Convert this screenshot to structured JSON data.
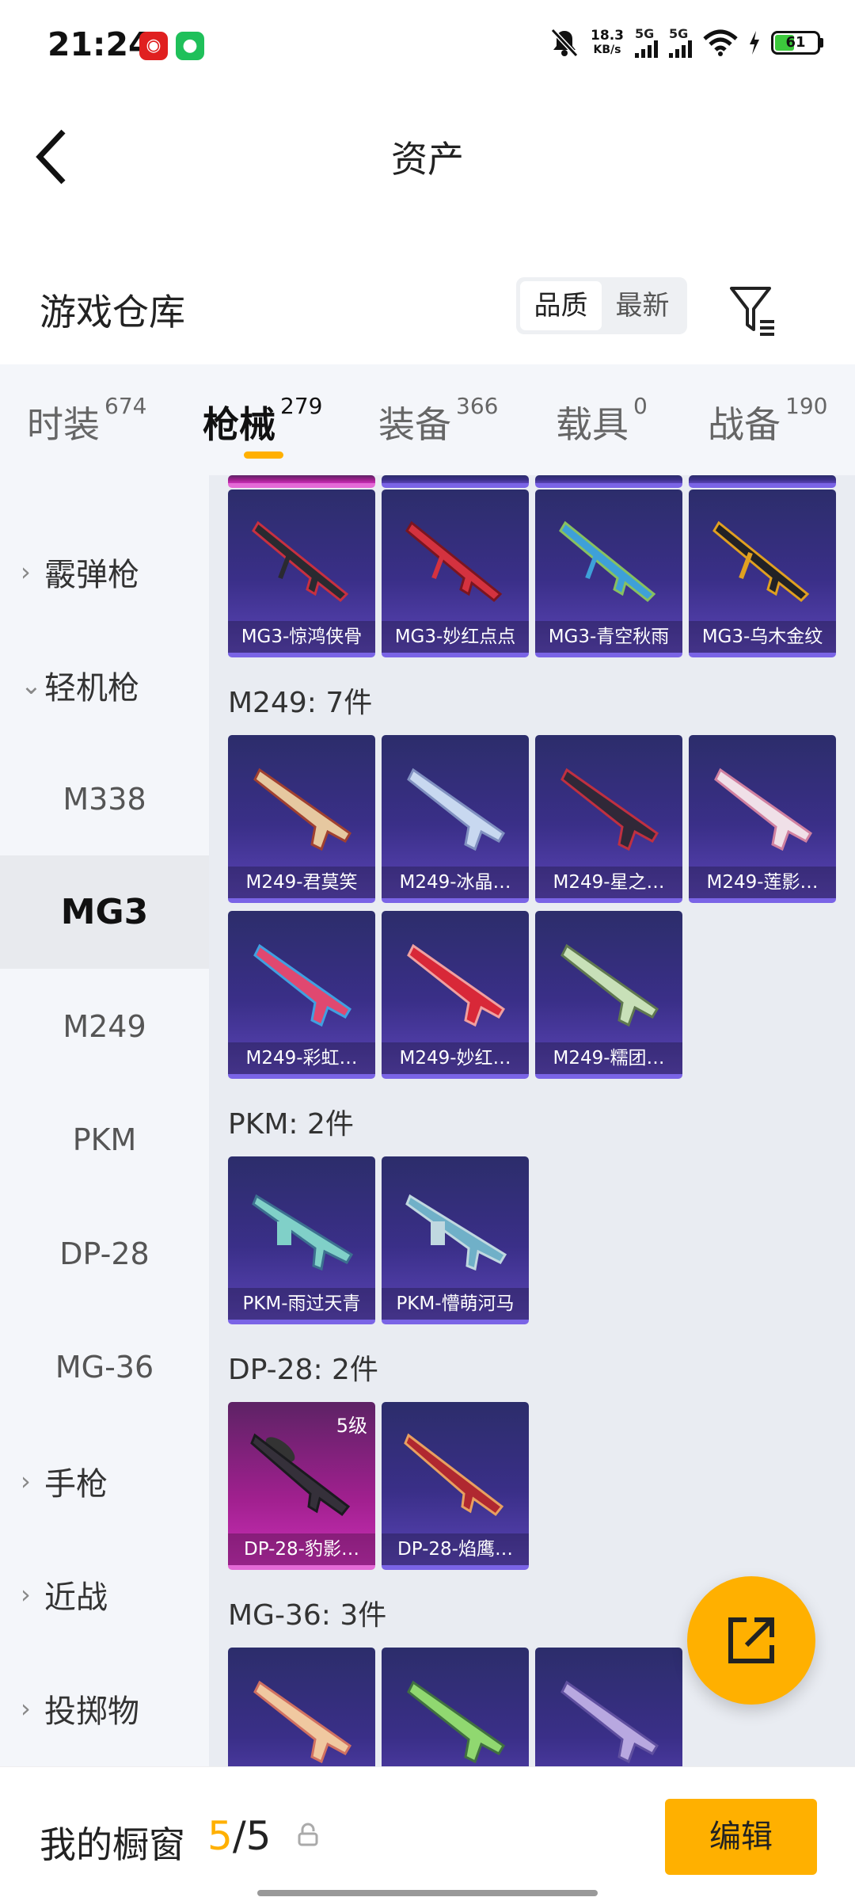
{
  "status": {
    "time": "21:24",
    "net_speed_value": "18.3",
    "net_speed_unit": "KB/s",
    "sig1": "5G",
    "sig2": "5G",
    "battery": "61"
  },
  "nav": {
    "title": "资产"
  },
  "warehouse": {
    "title": "游戏仓库",
    "sort_quality": "品质",
    "sort_latest": "最新"
  },
  "tabs": [
    {
      "label": "时装",
      "count": "674"
    },
    {
      "label": "枪械",
      "count": "279"
    },
    {
      "label": "装备",
      "count": "366"
    },
    {
      "label": "载具",
      "count": "0"
    },
    {
      "label": "战备",
      "count": "190"
    }
  ],
  "sidebar": [
    {
      "label": "霰弹枪",
      "chev": "›"
    },
    {
      "label": "轻机枪",
      "chev": "⌄"
    },
    {
      "label": "M338"
    },
    {
      "label": "MG3"
    },
    {
      "label": "M249"
    },
    {
      "label": "PKM"
    },
    {
      "label": "DP-28"
    },
    {
      "label": "MG-36"
    },
    {
      "label": "手枪",
      "chev": "›"
    },
    {
      "label": "近战",
      "chev": "›"
    },
    {
      "label": "投掷物",
      "chev": "›"
    }
  ],
  "groups": {
    "mg3": {
      "items": [
        "MG3-惊鸿侠骨",
        "MG3-妙红点点",
        "MG3-青空秋雨",
        "MG3-乌木金纹"
      ]
    },
    "m249": {
      "title": "M249: 7件",
      "items": [
        "M249-君莫笑",
        "M249-冰晶…",
        "M249-星之…",
        "M249-莲影…",
        "M249-彩虹…",
        "M249-妙红…",
        "M249-糯团…"
      ]
    },
    "pkm": {
      "title": "PKM: 2件",
      "items": [
        "PKM-雨过天青",
        "PKM-懵萌河马"
      ]
    },
    "dp28": {
      "title": "DP-28: 2件",
      "items": [
        "DP-28-豹影…",
        "DP-28-焰鹰…"
      ],
      "level": "5级"
    },
    "mg36": {
      "title": "MG-36: 3件"
    }
  },
  "bottom": {
    "showcase": "我的橱窗",
    "count_current": "5",
    "count_sep": "/",
    "count_total": "5",
    "edit": "编辑"
  },
  "colors": {
    "accent": "#ffb000",
    "card": "#3a2f88",
    "card_epic": "#a1208f"
  },
  "icons": [
    "back-arrow-icon",
    "filter-icon",
    "chevron-right-icon",
    "chevron-down-icon",
    "share-export-icon",
    "lock-icon",
    "mute-bell-icon",
    "wifi-icon",
    "charging-icon"
  ]
}
